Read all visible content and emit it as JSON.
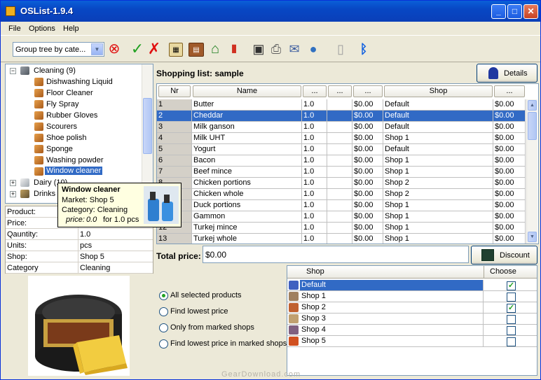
{
  "window": {
    "title": "OSList-1.9.4"
  },
  "menu": [
    "File",
    "Options",
    "Help"
  ],
  "toolbar": {
    "combo_value": "Group tree by cate..."
  },
  "tree": {
    "root": "Cleaning (9)",
    "items": [
      "Dishwashing Liquid",
      "Floor Cleaner",
      "Fly Spray",
      "Rubber Gloves",
      "Scourers",
      "Shoe polish",
      "Sponge",
      "Washing powder",
      "Window cleaner"
    ],
    "others": [
      "Dairy (10)",
      "Drinks ("
    ]
  },
  "tooltip": {
    "title": "Window cleaner",
    "market": "Market: Shop 5",
    "category": "Category: Cleaning",
    "price_label": "price:",
    "price_value": "0.0",
    "price_suffix": "for 1.0 pcs"
  },
  "props": [
    {
      "k": "Product:",
      "v": ""
    },
    {
      "k": "Price:",
      "v": ""
    },
    {
      "k": "Qauntity:",
      "v": "1.0"
    },
    {
      "k": "Units:",
      "v": "pcs"
    },
    {
      "k": "Shop:",
      "v": "Shop 5"
    },
    {
      "k": "Category",
      "v": "Cleaning"
    }
  ],
  "list": {
    "title": "Shopping list: sample",
    "details_label": "Details",
    "headers": [
      "Nr",
      "Name",
      "...",
      "...",
      "...",
      "Shop",
      "..."
    ],
    "rows": [
      [
        "1",
        "Butter",
        "1.0",
        "",
        "$0.00",
        "Default",
        "$0.00"
      ],
      [
        "2",
        "Cheddar",
        "1.0",
        "",
        "$0.00",
        "Default",
        "$0.00"
      ],
      [
        "3",
        "Milk ganson",
        "1.0",
        "",
        "$0.00",
        "Default",
        "$0.00"
      ],
      [
        "4",
        "Milk UHT",
        "1.0",
        "",
        "$0.00",
        "Shop 1",
        "$0.00"
      ],
      [
        "5",
        "Yogurt",
        "1.0",
        "",
        "$0.00",
        "Default",
        "$0.00"
      ],
      [
        "6",
        "Bacon",
        "1.0",
        "",
        "$0.00",
        "Shop 1",
        "$0.00"
      ],
      [
        "7",
        "Beef mince",
        "1.0",
        "",
        "$0.00",
        "Shop 1",
        "$0.00"
      ],
      [
        "8",
        "Chicken portions",
        "1.0",
        "",
        "$0.00",
        "Shop 2",
        "$0.00"
      ],
      [
        "9",
        "Chicken whole",
        "1.0",
        "",
        "$0.00",
        "Shop 2",
        "$0.00"
      ],
      [
        "10",
        "Duck portions",
        "1.0",
        "",
        "$0.00",
        "Shop 1",
        "$0.00"
      ],
      [
        "11",
        "Gammon",
        "1.0",
        "",
        "$0.00",
        "Shop 1",
        "$0.00"
      ],
      [
        "12",
        "Turkej mince",
        "1.0",
        "",
        "$0.00",
        "Shop 1",
        "$0.00"
      ],
      [
        "13",
        "Turkej whole",
        "1.0",
        "",
        "$0.00",
        "Shop 1",
        "$0.00"
      ]
    ],
    "selected_row": 1
  },
  "total": {
    "label": "Total price:",
    "value": "$0.00",
    "discount_label": "Discount"
  },
  "options": [
    {
      "label": "All selected products",
      "checked": true
    },
    {
      "label": "Find lowest price",
      "checked": false
    },
    {
      "label": "Only from marked shops",
      "checked": false
    },
    {
      "label": "Find lowest price in marked shops",
      "checked": false
    }
  ],
  "shops": {
    "headers": [
      "Shop",
      "Choose"
    ],
    "rows": [
      {
        "name": "Default",
        "checked": true
      },
      {
        "name": "Shop 1",
        "checked": false
      },
      {
        "name": "Shop 2",
        "checked": true
      },
      {
        "name": "Shop 3",
        "checked": false
      },
      {
        "name": "Shop 4",
        "checked": false
      },
      {
        "name": "Shop 5",
        "checked": false
      }
    ],
    "selected_row": 0
  },
  "watermark": "GearDownload.com",
  "colors": {
    "selection": "#316ac5",
    "title_bar": "#0a5fd8",
    "accent_green": "#21a121"
  }
}
